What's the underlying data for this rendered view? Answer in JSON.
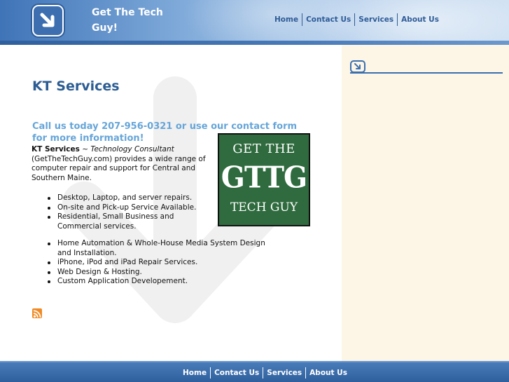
{
  "header": {
    "site_title": "Get The Tech Guy!",
    "nav": [
      "Home",
      "Contact Us",
      "Services",
      "About Us"
    ]
  },
  "main": {
    "page_title": "KT Services",
    "callout": "Call us today 207-956-0321 or use our contact form for more information!",
    "intro_company": "KT Services",
    "intro_sep": " ~ ",
    "intro_role": "Technology Consultant",
    "intro_rest": " (GetTheTechGuy.com) provides a wide range of computer repair and support for Central and Southern Maine.",
    "services_group1": [
      "Desktop, Laptop, and server repairs.",
      "On-site and Pick-up Service Available.",
      "Residential, Small Business and Commercial services."
    ],
    "services_group2": [
      "Home Automation & Whole-House Media System Design and Installation.",
      "iPhone, iPod and iPad Repair Services.",
      "Web Design & Hosting.",
      "Custom Application Developement."
    ],
    "badge": {
      "line1": "GET THE",
      "line2": "GTTG",
      "line3": "TECH GUY",
      "color": "#2f6b3e"
    },
    "rss_icon": "rss-feed-icon"
  },
  "footer": {
    "nav": [
      "Home",
      "Contact Us",
      "Services",
      "About Us"
    ]
  },
  "colors": {
    "brand_blue": "#3a6fb0",
    "callout_blue": "#66a5d8",
    "title_blue": "#2b5d93",
    "sidebar_bg": "#fdf6e6"
  }
}
